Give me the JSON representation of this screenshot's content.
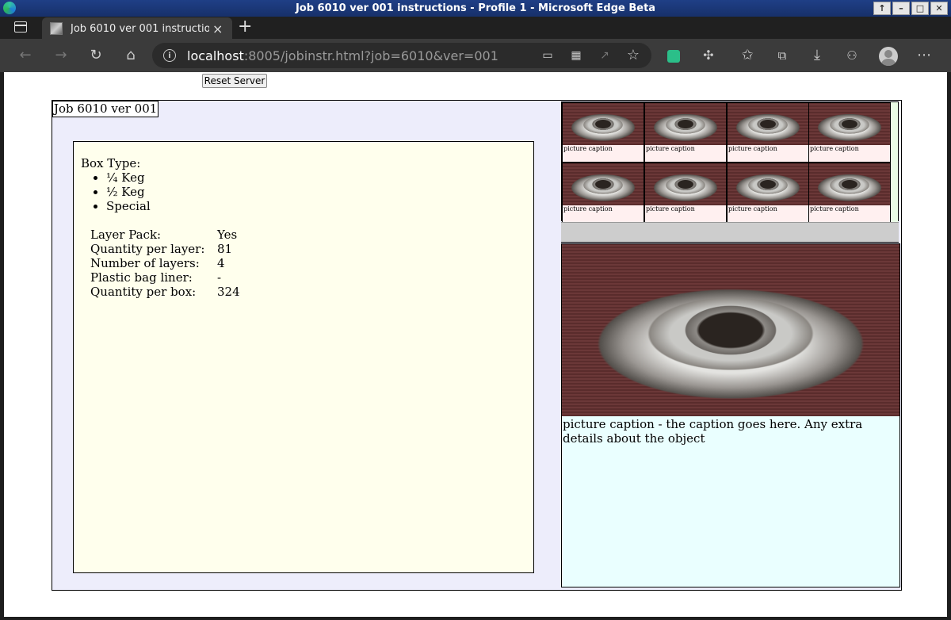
{
  "window": {
    "title": "Job 6010 ver 001 instructions - Profile 1 - Microsoft Edge Beta",
    "buttons": [
      "↑",
      "–",
      "□",
      "✕"
    ]
  },
  "tab": {
    "title": "Job 6010 ver 001 instructions - Profile 1",
    "close": "×",
    "new_tab": "+"
  },
  "address_bar": {
    "host": "localhost",
    "rest": ":8005/jobinstr.html?job=6010&ver=001"
  },
  "page": {
    "reset_button": "Reset Server",
    "job_title": "Job 6010 ver 001",
    "box_type_label": "Box Type:",
    "box_types": [
      "¼ Keg",
      "½ Keg",
      "Special"
    ],
    "specs": [
      {
        "label": "Layer Pack:",
        "value": "Yes"
      },
      {
        "label": "Quantity per layer:",
        "value": "81"
      },
      {
        "label": "Number of layers:",
        "value": "4"
      },
      {
        "label": "Plastic bag liner:",
        "value": "-"
      },
      {
        "label": "Quantity per box:",
        "value": "324"
      }
    ],
    "thumbnails": [
      {
        "caption": "picture caption"
      },
      {
        "caption": "picture caption"
      },
      {
        "caption": "picture caption"
      },
      {
        "caption": "picture caption"
      },
      {
        "caption": "picture caption"
      },
      {
        "caption": "picture caption"
      },
      {
        "caption": "picture caption"
      },
      {
        "caption": "picture caption"
      }
    ],
    "main_caption": "picture caption - the caption goes here. Any extra details about the object"
  }
}
